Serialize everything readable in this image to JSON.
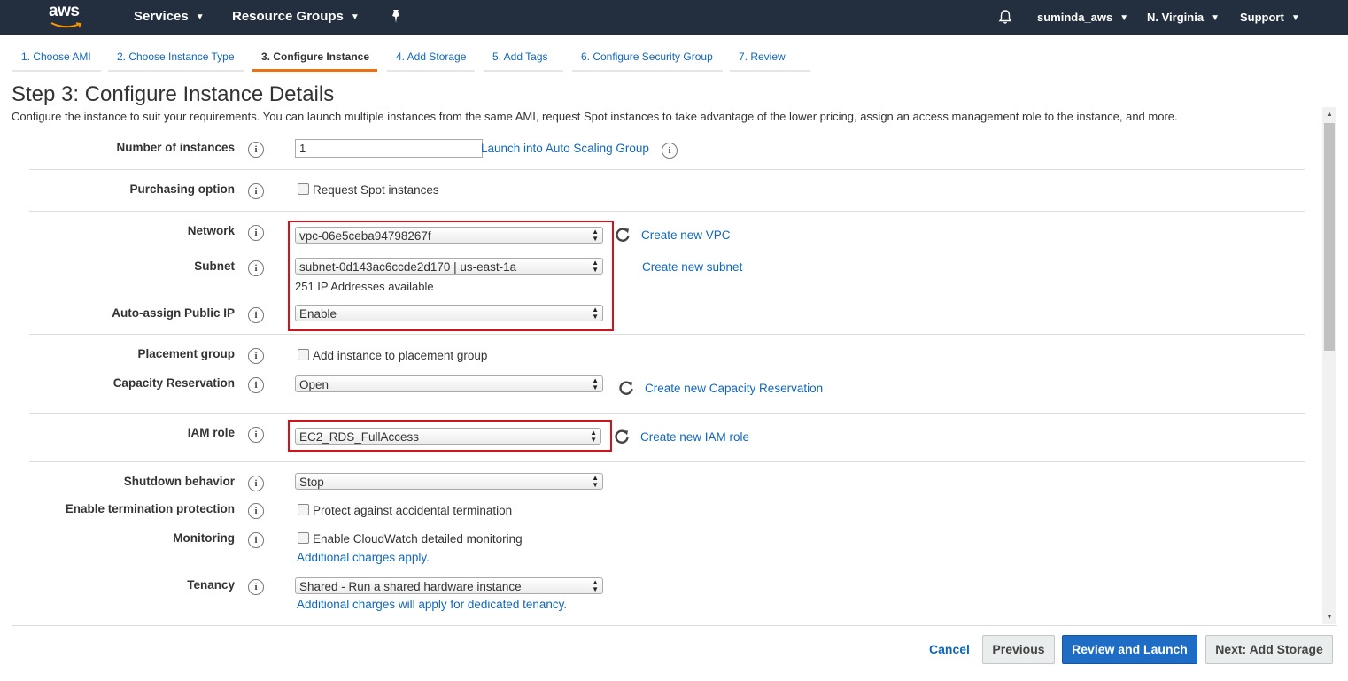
{
  "topnav": {
    "logo_text": "aws",
    "services": "Services",
    "resource_groups": "Resource Groups",
    "user": "suminda_aws",
    "region": "N. Virginia",
    "support": "Support"
  },
  "wizard_tabs": [
    {
      "label": "1. Choose AMI",
      "active": false
    },
    {
      "label": "2. Choose Instance Type",
      "active": false
    },
    {
      "label": "3. Configure Instance",
      "active": true
    },
    {
      "label": "4. Add Storage",
      "active": false
    },
    {
      "label": "5. Add Tags",
      "active": false
    },
    {
      "label": "6. Configure Security Group",
      "active": false
    },
    {
      "label": "7. Review",
      "active": false
    }
  ],
  "page": {
    "title": "Step 3: Configure Instance Details",
    "description": "Configure the instance to suit your requirements. You can launch multiple instances from the same AMI, request Spot instances to take advantage of the lower pricing, assign an access management role to the instance, and more."
  },
  "form": {
    "number_of_instances": {
      "label": "Number of instances",
      "value": "1",
      "link": "Launch into Auto Scaling Group"
    },
    "purchasing_option": {
      "label": "Purchasing option",
      "checkbox": "Request Spot instances"
    },
    "network": {
      "label": "Network",
      "value": "vpc-06e5ceba94798267f",
      "link": "Create new VPC"
    },
    "subnet": {
      "label": "Subnet",
      "value": "subnet-0d143ac6ccde2d170 | us-east-1a",
      "note": "251 IP Addresses available",
      "link": "Create new subnet"
    },
    "auto_assign_ip": {
      "label": "Auto-assign Public IP",
      "value": "Enable"
    },
    "placement_group": {
      "label": "Placement group",
      "checkbox": "Add instance to placement group"
    },
    "capacity_reservation": {
      "label": "Capacity Reservation",
      "value": "Open",
      "link": "Create new Capacity Reservation"
    },
    "iam_role": {
      "label": "IAM role",
      "value": "EC2_RDS_FullAccess",
      "link": "Create new IAM role"
    },
    "shutdown_behavior": {
      "label": "Shutdown behavior",
      "value": "Stop"
    },
    "termination_protection": {
      "label": "Enable termination protection",
      "checkbox": "Protect against accidental termination"
    },
    "monitoring": {
      "label": "Monitoring",
      "checkbox": "Enable CloudWatch detailed monitoring",
      "link": "Additional charges apply."
    },
    "tenancy": {
      "label": "Tenancy",
      "value": "Shared - Run a shared hardware instance",
      "link": "Additional charges will apply for dedicated tenancy."
    }
  },
  "footer": {
    "cancel": "Cancel",
    "previous": "Previous",
    "review_launch": "Review and Launch",
    "next": "Next: Add Storage"
  },
  "colors": {
    "nav_bg": "#232f3e",
    "link": "#1166bb",
    "active_tab": "#ec7211",
    "highlight": "#d0141f",
    "primary_button": "#1f6cc5"
  }
}
